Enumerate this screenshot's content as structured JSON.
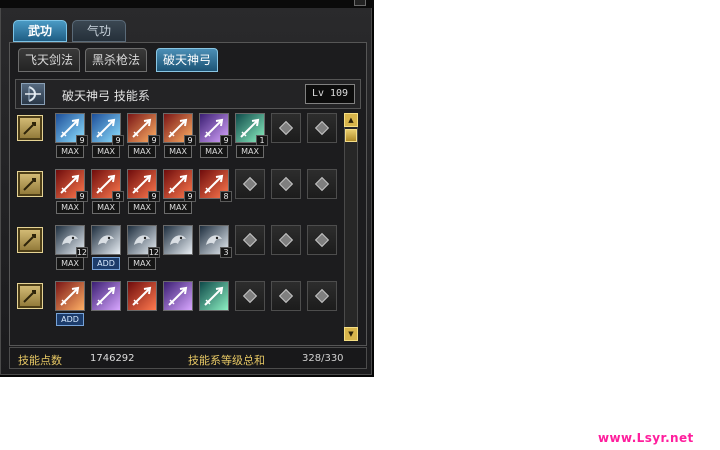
{
  "window": {
    "main_tabs": [
      {
        "label": "武功",
        "active": true
      },
      {
        "label": "气功",
        "active": false
      }
    ],
    "sub_tabs": [
      {
        "label": "飞天剑法",
        "active": false
      },
      {
        "label": "黑杀枪法",
        "active": false
      },
      {
        "label": "破天神弓",
        "active": true
      }
    ],
    "school": {
      "name": "破天神弓 技能系",
      "level": "Lv 109"
    },
    "rows": [
      {
        "skills": [
          {
            "icon": "bow-arrow-icon",
            "count": "9",
            "badge": "MAX"
          },
          {
            "icon": "bow-arrow-icon",
            "count": "9",
            "badge": "MAX"
          },
          {
            "icon": "fire-arrow-icon",
            "count": "9",
            "badge": "MAX"
          },
          {
            "icon": "fire-arrow-icon",
            "count": "9",
            "badge": "MAX"
          },
          {
            "icon": "purple-arrow-icon",
            "count": "9",
            "badge": "MAX"
          },
          {
            "icon": "green-arrow-icon",
            "count": "1",
            "badge": "MAX"
          }
        ]
      },
      {
        "skills": [
          {
            "icon": "red-arrow-icon",
            "count": "9",
            "badge": "MAX"
          },
          {
            "icon": "red-arrow-icon",
            "count": "9",
            "badge": "MAX"
          },
          {
            "icon": "red-arrow-icon",
            "count": "9",
            "badge": "MAX"
          },
          {
            "icon": "red-arrow-icon",
            "count": "9",
            "badge": "MAX"
          },
          {
            "icon": "red-arrow-icon",
            "count": "8",
            "badge": ""
          }
        ]
      },
      {
        "skills": [
          {
            "icon": "eagle-icon",
            "count": "12",
            "badge": "MAX"
          },
          {
            "icon": "eagle-icon",
            "count": "",
            "badge": "ADD"
          },
          {
            "icon": "eagle-icon",
            "count": "12",
            "badge": "MAX"
          },
          {
            "icon": "eagle-icon",
            "count": "",
            "badge": ""
          },
          {
            "icon": "eagle-icon",
            "count": "3",
            "badge": ""
          }
        ]
      },
      {
        "skills": [
          {
            "icon": "fire-arrow-icon",
            "count": "",
            "badge": "ADD"
          },
          {
            "icon": "purple-arrow-icon",
            "count": "",
            "badge": ""
          },
          {
            "icon": "red-arrow-icon",
            "count": "",
            "badge": ""
          },
          {
            "icon": "purple-arrow-icon",
            "count": "",
            "badge": ""
          },
          {
            "icon": "green-arrow-icon",
            "count": "",
            "badge": ""
          }
        ]
      }
    ],
    "footer": {
      "points_label": "技能点数",
      "points_value": "1746292",
      "total_label": "技能系等级总和",
      "total_value": "328/330"
    },
    "colors": {
      "accent": "#3d87b4",
      "gold": "#e6c764"
    }
  },
  "watermark": "www.Lsyr.net"
}
